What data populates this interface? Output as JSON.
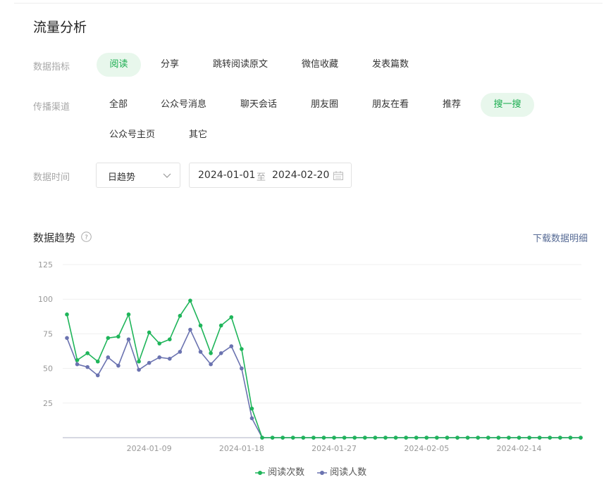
{
  "page_title": "流量分析",
  "metrics": {
    "label": "数据指标",
    "options": [
      "阅读",
      "分享",
      "跳转阅读原文",
      "微信收藏",
      "发表篇数"
    ],
    "active_index": 0
  },
  "channels": {
    "label": "传播渠道",
    "options": [
      "全部",
      "公众号消息",
      "聊天会话",
      "朋友圈",
      "朋友在看",
      "推荐",
      "搜一搜",
      "公众号主页",
      "其它"
    ],
    "active_index": 6
  },
  "time": {
    "label": "数据时间",
    "granularity": "日趋势",
    "start": "2024-01-01",
    "separator": "至",
    "end": "2024-02-20"
  },
  "trend": {
    "title": "数据趋势",
    "download_label": "下载数据明细"
  },
  "colors": {
    "accent": "#1aad4f",
    "active_bg": "#e8f7ec",
    "series_reads": "#1fb55a",
    "series_readers": "#6b73b0",
    "link": "#576b95"
  },
  "chart_data": {
    "type": "line",
    "ylim": [
      0,
      125
    ],
    "yticks": [
      25,
      50,
      75,
      100,
      125
    ],
    "x_tick_labels": [
      "2024-01-09",
      "2024-01-18",
      "2024-01-27",
      "2024-02-05",
      "2024-02-14"
    ],
    "x_tick_day_index": [
      8,
      17,
      26,
      35,
      44
    ],
    "x_start": "2024-01-01",
    "x_end": "2024-02-20",
    "series": [
      {
        "name": "阅读次数",
        "color": "#1fb55a",
        "values": [
          89,
          56,
          61,
          55,
          72,
          73,
          89,
          55,
          76,
          68,
          71,
          88,
          99,
          81,
          61,
          81,
          87,
          64,
          21,
          0,
          0,
          0,
          0,
          0,
          0,
          0,
          0,
          0,
          0,
          0,
          0,
          0,
          0,
          0,
          0,
          0,
          0,
          0,
          0,
          0,
          0,
          0,
          0,
          0,
          0,
          0,
          0,
          0,
          0,
          0,
          0
        ]
      },
      {
        "name": "阅读人数",
        "color": "#6b73b0",
        "values": [
          72,
          53,
          51,
          45,
          58,
          52,
          71,
          49,
          54,
          58,
          57,
          62,
          78,
          62,
          53,
          61,
          66,
          50,
          14,
          0,
          0,
          0,
          0,
          0,
          0,
          0,
          0,
          0,
          0,
          0,
          0,
          0,
          0,
          0,
          0,
          0,
          0,
          0,
          0,
          0,
          0,
          0,
          0,
          0,
          0,
          0,
          0,
          0,
          0,
          0,
          0
        ]
      }
    ]
  }
}
